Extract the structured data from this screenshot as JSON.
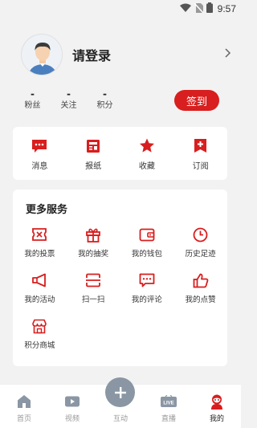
{
  "status_bar": {
    "time": "9:57"
  },
  "profile": {
    "login_label": "请登录"
  },
  "stats": [
    {
      "value": "-",
      "label": "粉丝"
    },
    {
      "value": "-",
      "label": "关注"
    },
    {
      "value": "-",
      "label": "积分"
    }
  ],
  "checkin_label": "签到",
  "quick": [
    {
      "label": "消息",
      "icon": "message-icon"
    },
    {
      "label": "报纸",
      "icon": "newspaper-icon"
    },
    {
      "label": "收藏",
      "icon": "star-icon"
    },
    {
      "label": "订阅",
      "icon": "subscribe-icon"
    }
  ],
  "services": {
    "title": "更多服务",
    "items": [
      {
        "label": "我的投票",
        "icon": "vote-icon"
      },
      {
        "label": "我的抽奖",
        "icon": "gift-icon"
      },
      {
        "label": "我的钱包",
        "icon": "wallet-icon"
      },
      {
        "label": "历史足迹",
        "icon": "clock-icon"
      },
      {
        "label": "我的活动",
        "icon": "megaphone-icon"
      },
      {
        "label": "扫一扫",
        "icon": "scan-icon"
      },
      {
        "label": "我的评论",
        "icon": "comment-icon"
      },
      {
        "label": "我的点赞",
        "icon": "thumbs-up-icon"
      },
      {
        "label": "积分商城",
        "icon": "shop-icon"
      }
    ]
  },
  "nav": [
    {
      "label": "首页",
      "icon": "home-icon"
    },
    {
      "label": "视频",
      "icon": "video-icon"
    },
    {
      "label": "互动",
      "icon": "plus-icon"
    },
    {
      "label": "直播",
      "icon": "live-icon"
    },
    {
      "label": "我的",
      "icon": "profile-icon"
    }
  ],
  "colors": {
    "accent": "#d81e1e",
    "nav_inactive": "#999999",
    "plus_bg": "#8a96a3"
  }
}
